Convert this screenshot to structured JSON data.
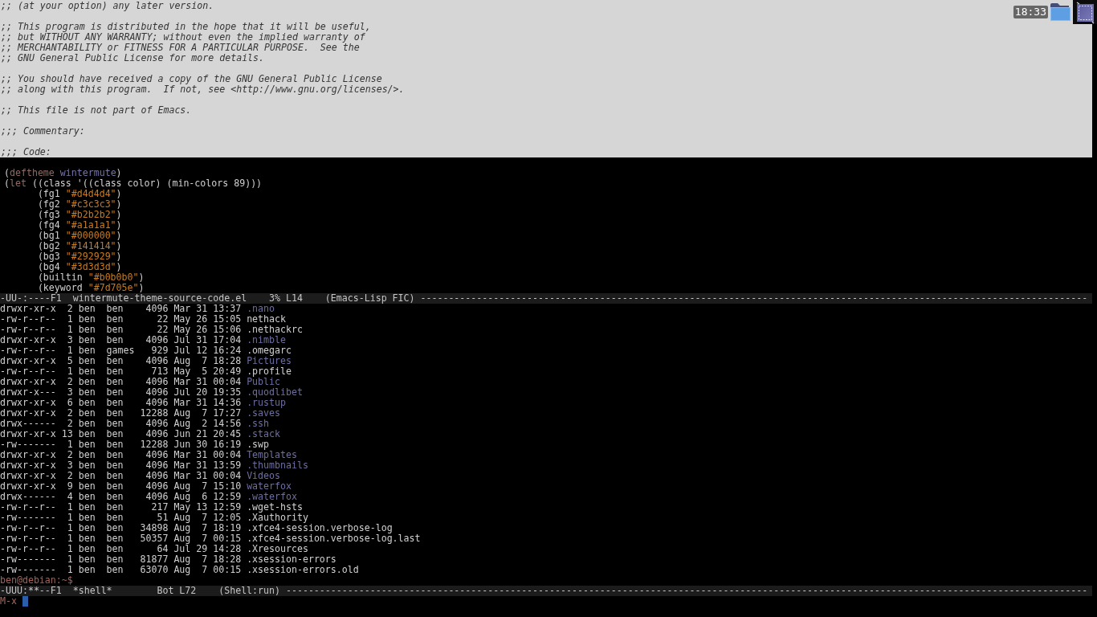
{
  "comment_pane": {
    "paragraphs": [
      [
        ";; (at your option) any later version."
      ],
      [
        ";; This program is distributed in the hope that it will be useful,",
        ";; but WITHOUT ANY WARRANTY; without even the implied warranty of",
        ";; MERCHANTABILITY or FITNESS FOR A PARTICULAR PURPOSE.  See the",
        ";; GNU General Public License for more details."
      ],
      [
        ";; You should have received a copy of the GNU General Public License",
        ";; along with this program.  If not, see <http://www.gnu.org/licenses/>."
      ],
      [
        ";; This file is not part of Emacs."
      ],
      [
        ";;; Commentary:"
      ],
      [
        ";;; Code:"
      ]
    ]
  },
  "tray": {
    "clock": "18:33"
  },
  "code_buffer": {
    "lines": [
      {
        "tokens": [
          {
            "text": "(",
            "kind": "plain"
          },
          {
            "text": "deftheme",
            "kind": "keyword"
          },
          {
            "text": " wintermute",
            "kind": "constant"
          },
          {
            "text": ")",
            "kind": "plain"
          }
        ]
      },
      {
        "tokens": [
          {
            "text": "(",
            "kind": "plain"
          },
          {
            "text": "let",
            "kind": "keyword"
          },
          {
            "text": " ((class '((class color) (min-colors 89)))",
            "kind": "plain"
          }
        ],
        "children": [
          {
            "tokens": [
              {
                "text": "(fg1 ",
                "kind": "plain"
              },
              {
                "text": "\"#d4d4d4\"",
                "kind": "string"
              },
              {
                "text": ")",
                "kind": "plain"
              }
            ]
          },
          {
            "tokens": [
              {
                "text": "(fg2 ",
                "kind": "plain"
              },
              {
                "text": "\"#c3c3c3\"",
                "kind": "string"
              },
              {
                "text": ")",
                "kind": "plain"
              }
            ]
          },
          {
            "tokens": [
              {
                "text": "(fg3 ",
                "kind": "plain"
              },
              {
                "text": "\"#b2b2b2\"",
                "kind": "string"
              },
              {
                "text": ")",
                "kind": "plain"
              }
            ]
          },
          {
            "tokens": [
              {
                "text": "(fg4 ",
                "kind": "plain"
              },
              {
                "text": "\"#a1a1a1\"",
                "kind": "string"
              },
              {
                "text": ")",
                "kind": "plain"
              }
            ]
          },
          {
            "tokens": [
              {
                "text": "(bg1 ",
                "kind": "plain"
              },
              {
                "text": "\"#000000\"",
                "kind": "string"
              },
              {
                "text": ")",
                "kind": "plain"
              }
            ]
          },
          {
            "tokens": [
              {
                "text": "(bg2 ",
                "kind": "plain"
              },
              {
                "text": "\"#141414\"",
                "kind": "string"
              },
              {
                "text": ")",
                "kind": "plain"
              }
            ]
          },
          {
            "tokens": [
              {
                "text": "(bg3 ",
                "kind": "plain"
              },
              {
                "text": "\"#292929\"",
                "kind": "string"
              },
              {
                "text": ")",
                "kind": "plain"
              }
            ]
          },
          {
            "tokens": [
              {
                "text": "(bg4 ",
                "kind": "plain"
              },
              {
                "text": "\"#3d3d3d\"",
                "kind": "string"
              },
              {
                "text": ")",
                "kind": "plain"
              }
            ]
          },
          {
            "tokens": [
              {
                "text": "(builtin ",
                "kind": "plain"
              },
              {
                "text": "\"#b0b0b0\"",
                "kind": "string"
              },
              {
                "text": ")",
                "kind": "plain"
              }
            ]
          },
          {
            "tokens": [
              {
                "text": "(keyword ",
                "kind": "plain"
              },
              {
                "text": "\"#7d705e\"",
                "kind": "string"
              },
              {
                "text": ")",
                "kind": "plain"
              }
            ]
          }
        ]
      }
    ]
  },
  "code_mode_line": {
    "status": "-UU-:----F1",
    "buffer": "wintermute-theme-source-code.el",
    "percent": "3%",
    "line": "L14",
    "mode": "(Emacs-Lisp FIC)",
    "fill": "-----------------------------------------------------------------------------------------------------------------------"
  },
  "shell_buffer": {
    "rows": [
      {
        "mode": "drwxr-xr-x",
        "links": "2",
        "owner": "ben",
        "group": "ben",
        "size": "4096",
        "date": "Mar 31 13:37",
        "name": ".nano",
        "kind": "directory"
      },
      {
        "mode": "-rw-r--r--",
        "links": "1",
        "owner": "ben",
        "group": "ben",
        "size": "22",
        "date": "May 26 15:05",
        "name": "nethack",
        "kind": "file"
      },
      {
        "mode": "-rw-r--r--",
        "links": "1",
        "owner": "ben",
        "group": "ben",
        "size": "22",
        "date": "May 26 15:06",
        "name": ".nethackrc",
        "kind": "file"
      },
      {
        "mode": "drwxr-xr-x",
        "links": "3",
        "owner": "ben",
        "group": "ben",
        "size": "4096",
        "date": "Jul 31 17:04",
        "name": ".nimble",
        "kind": "directory"
      },
      {
        "mode": "-rw-r--r--",
        "links": "1",
        "owner": "ben",
        "group": "games",
        "size": "929",
        "date": "Jul 12 16:24",
        "name": ".omegarc",
        "kind": "file"
      },
      {
        "mode": "drwxr-xr-x",
        "links": "5",
        "owner": "ben",
        "group": "ben",
        "size": "4096",
        "date": "Aug  7 18:28",
        "name": "Pictures",
        "kind": "directory"
      },
      {
        "mode": "-rw-r--r--",
        "links": "1",
        "owner": "ben",
        "group": "ben",
        "size": "713",
        "date": "May  5 20:49",
        "name": ".profile",
        "kind": "file"
      },
      {
        "mode": "drwxr-xr-x",
        "links": "2",
        "owner": "ben",
        "group": "ben",
        "size": "4096",
        "date": "Mar 31 00:04",
        "name": "Public",
        "kind": "directory"
      },
      {
        "mode": "drwxr-x---",
        "links": "3",
        "owner": "ben",
        "group": "ben",
        "size": "4096",
        "date": "Jul 20 19:35",
        "name": ".quodlibet",
        "kind": "directory"
      },
      {
        "mode": "drwxr-xr-x",
        "links": "6",
        "owner": "ben",
        "group": "ben",
        "size": "4096",
        "date": "Mar 31 14:36",
        "name": ".rustup",
        "kind": "directory"
      },
      {
        "mode": "drwxr-xr-x",
        "links": "2",
        "owner": "ben",
        "group": "ben",
        "size": "12288",
        "date": "Aug  7 17:27",
        "name": ".saves",
        "kind": "directory"
      },
      {
        "mode": "drwx------",
        "links": "2",
        "owner": "ben",
        "group": "ben",
        "size": "4096",
        "date": "Aug  2 14:56",
        "name": ".ssh",
        "kind": "directory"
      },
      {
        "mode": "drwxr-xr-x",
        "links": "13",
        "owner": "ben",
        "group": "ben",
        "size": "4096",
        "date": "Jun 21 20:45",
        "name": ".stack",
        "kind": "directory"
      },
      {
        "mode": "-rw-------",
        "links": "1",
        "owner": "ben",
        "group": "ben",
        "size": "12288",
        "date": "Jun 30 16:19",
        "name": ".swp",
        "kind": "file"
      },
      {
        "mode": "drwxr-xr-x",
        "links": "2",
        "owner": "ben",
        "group": "ben",
        "size": "4096",
        "date": "Mar 31 00:04",
        "name": "Templates",
        "kind": "directory"
      },
      {
        "mode": "drwxr-xr-x",
        "links": "3",
        "owner": "ben",
        "group": "ben",
        "size": "4096",
        "date": "Mar 31 13:59",
        "name": ".thumbnails",
        "kind": "directory"
      },
      {
        "mode": "drwxr-xr-x",
        "links": "2",
        "owner": "ben",
        "group": "ben",
        "size": "4096",
        "date": "Mar 31 00:04",
        "name": "Videos",
        "kind": "directory"
      },
      {
        "mode": "drwxr-xr-x",
        "links": "9",
        "owner": "ben",
        "group": "ben",
        "size": "4096",
        "date": "Aug  7 15:10",
        "name": "waterfox",
        "kind": "directory"
      },
      {
        "mode": "drwx------",
        "links": "4",
        "owner": "ben",
        "group": "ben",
        "size": "4096",
        "date": "Aug  6 12:59",
        "name": ".waterfox",
        "kind": "directory"
      },
      {
        "mode": "-rw-r--r--",
        "links": "1",
        "owner": "ben",
        "group": "ben",
        "size": "217",
        "date": "May 13 12:59",
        "name": ".wget-hsts",
        "kind": "file"
      },
      {
        "mode": "-rw-------",
        "links": "1",
        "owner": "ben",
        "group": "ben",
        "size": "51",
        "date": "Aug  7 12:05",
        "name": ".Xauthority",
        "kind": "file"
      },
      {
        "mode": "-rw-r--r--",
        "links": "1",
        "owner": "ben",
        "group": "ben",
        "size": "34898",
        "date": "Aug  7 18:19",
        "name": ".xfce4-session.verbose-log",
        "kind": "file"
      },
      {
        "mode": "-rw-r--r--",
        "links": "1",
        "owner": "ben",
        "group": "ben",
        "size": "50357",
        "date": "Aug  7 00:15",
        "name": ".xfce4-session.verbose-log.last",
        "kind": "file"
      },
      {
        "mode": "-rw-r--r--",
        "links": "1",
        "owner": "ben",
        "group": "ben",
        "size": "64",
        "date": "Jul 29 14:28",
        "name": ".Xresources",
        "kind": "file"
      },
      {
        "mode": "-rw-------",
        "links": "1",
        "owner": "ben",
        "group": "ben",
        "size": "81877",
        "date": "Aug  7 18:28",
        "name": ".xsession-errors",
        "kind": "file"
      },
      {
        "mode": "-rw-------",
        "links": "1",
        "owner": "ben",
        "group": "ben",
        "size": "63070",
        "date": "Aug  7 00:15",
        "name": ".xsession-errors.old",
        "kind": "file"
      }
    ],
    "prompt": "ben@debian:~$"
  },
  "shell_mode_line": {
    "status": "-UUU:**--F1",
    "buffer": "*shell*",
    "percent": "Bot",
    "line": "L72",
    "mode": "(Shell:run)",
    "fill": "-----------------------------------------------------------------------------------------------------------------------------------------------"
  },
  "minibuffer": {
    "prompt": "M-x"
  }
}
